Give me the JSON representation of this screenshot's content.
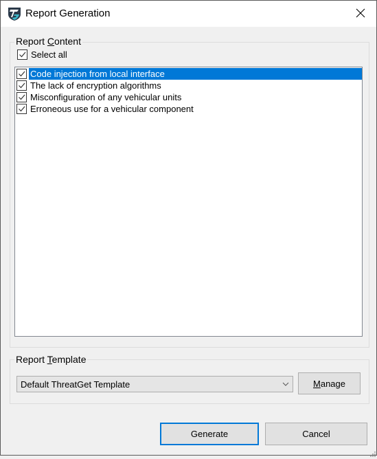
{
  "window": {
    "title": "Report Generation",
    "app_icon": "threatget-logo-icon",
    "close_icon": "close-icon"
  },
  "report_content": {
    "group_label_prefix": "Report ",
    "group_label_accel": "C",
    "group_label_suffix": "ontent",
    "select_all": {
      "label": "Select all",
      "checked": true
    },
    "items": [
      {
        "label": "Code injection from local interface",
        "checked": true,
        "selected": true
      },
      {
        "label": "The lack of encryption algorithms",
        "checked": true,
        "selected": false
      },
      {
        "label": "Misconfiguration of any vehicular units",
        "checked": true,
        "selected": false
      },
      {
        "label": "Erroneous use for a vehicular component",
        "checked": true,
        "selected": false
      }
    ]
  },
  "report_template": {
    "group_label_prefix": "Report ",
    "group_label_accel": "T",
    "group_label_suffix": "emplate",
    "selected_template": "Default ThreatGet Template",
    "manage_accel": "M",
    "manage_rest": "anage"
  },
  "footer": {
    "generate_label": "Generate",
    "cancel_label": "Cancel"
  }
}
